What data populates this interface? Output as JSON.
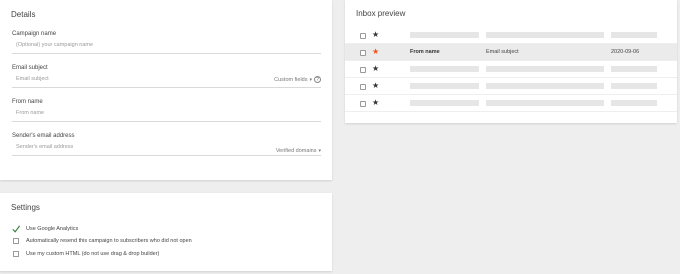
{
  "details": {
    "title": "Details",
    "campaign_name": {
      "label": "Campaign name",
      "placeholder": "(Optional) your campaign name"
    },
    "email_subject": {
      "label": "Email subject",
      "placeholder": "Email subject",
      "custom_fields": "Custom fields",
      "help_icon": "?"
    },
    "from_name": {
      "label": "From name",
      "placeholder": "From name"
    },
    "sender_email": {
      "label": "Sender's email address",
      "placeholder": "Sender's email address",
      "verified_domains": "Verified domains",
      "caret": "▾"
    }
  },
  "settings": {
    "title": "Settings",
    "options": [
      {
        "label": "Use Google Analytics",
        "checked": true
      },
      {
        "label": "Automatically resend this campaign to subscribers who did not open",
        "checked": false
      },
      {
        "label": "Use my custom HTML (do not use drag & drop builder)",
        "checked": false
      }
    ]
  },
  "inbox": {
    "title": "Inbox preview",
    "star": "★",
    "preview_row": {
      "from_name": "From name",
      "subject": "Email subject",
      "date": "2020-09-06"
    }
  },
  "colors": {
    "accent_star": "#f4511e",
    "check_green": "#2e7d32"
  }
}
